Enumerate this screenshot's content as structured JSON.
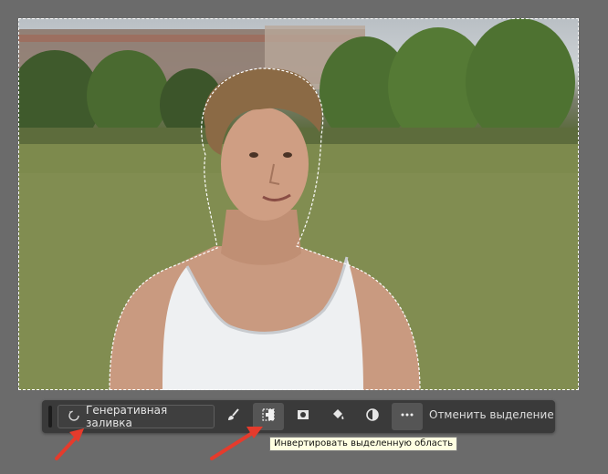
{
  "taskbar": {
    "generative_fill_label": "Генеративная заливка",
    "deselect_label": "Отменить выделение",
    "tools": [
      {
        "icon": "brush-icon"
      },
      {
        "icon": "invert-selection-icon"
      },
      {
        "icon": "mask-icon"
      },
      {
        "icon": "paint-bucket-icon"
      },
      {
        "icon": "adjustment-circle-icon"
      },
      {
        "icon": "more-dots-icon"
      }
    ]
  },
  "tooltip": {
    "text": "Инвертировать выделенную область"
  },
  "colors": {
    "workspace": "#6b6b6b",
    "taskbar": "#3a3a3a",
    "arrow": "#e53b2c",
    "tooltip_bg": "#ffffe1"
  }
}
